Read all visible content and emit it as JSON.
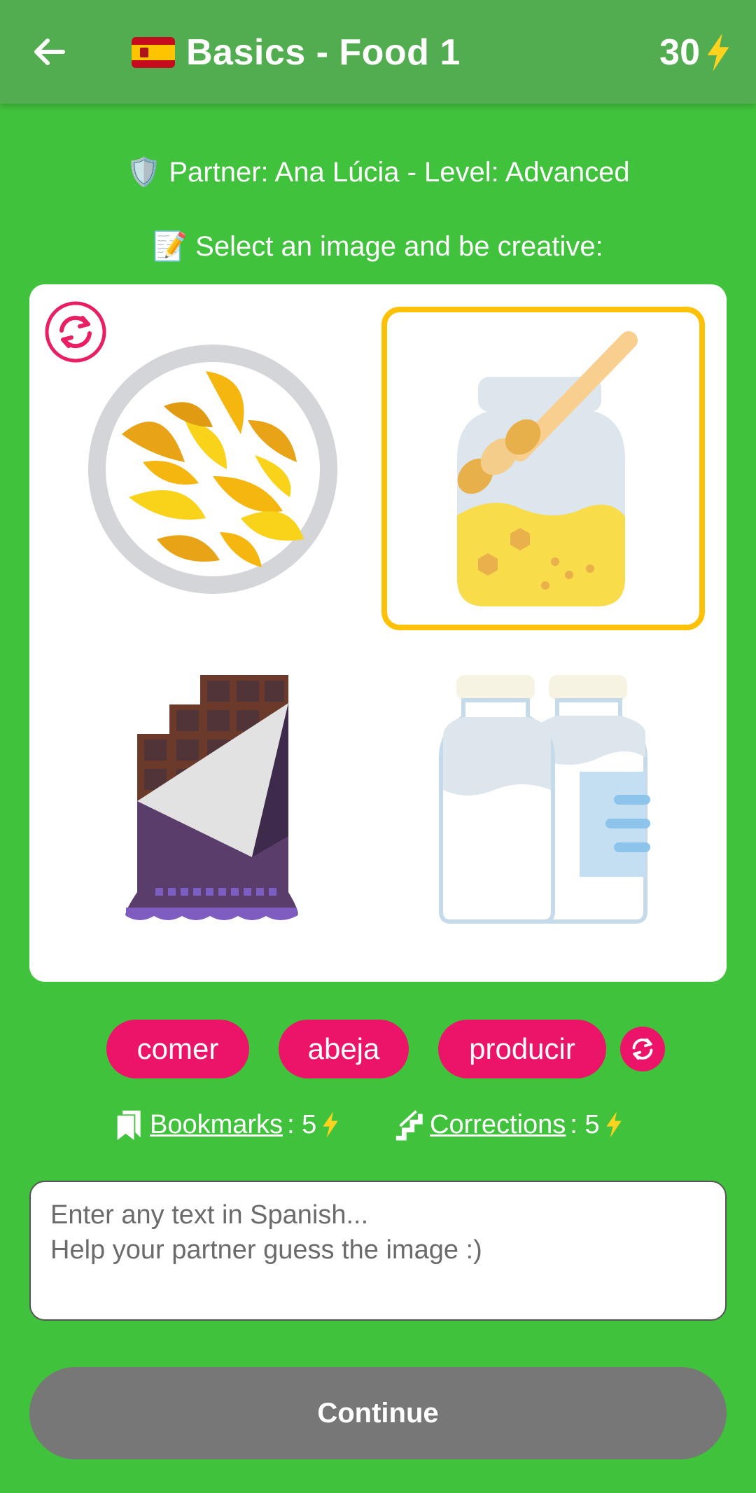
{
  "header": {
    "title": "Basics - Food 1",
    "flag_icon": "spain-flag-icon",
    "score": "30",
    "score_icon": "lightning-icon"
  },
  "partner_line": "🛡️ Partner: Ana Lúcia - Level: Advanced",
  "instruction_line": "📝 Select an image and be creative:",
  "images": [
    {
      "icon": "potato-wedges-plate-icon",
      "selected": false
    },
    {
      "icon": "honey-jar-icon",
      "selected": true
    },
    {
      "icon": "chocolate-bar-icon",
      "selected": false
    },
    {
      "icon": "milk-bottles-icon",
      "selected": false
    }
  ],
  "words": [
    "comer",
    "abeja",
    "producir"
  ],
  "stats": {
    "bookmarks_label": "Bookmarks",
    "bookmarks_value": ": 5",
    "corrections_label": "Corrections",
    "corrections_value": ": 5"
  },
  "input": {
    "placeholder": "Enter any text in Spanish...\nHelp your partner guess the image :)",
    "value": ""
  },
  "continue_label": "Continue",
  "colors": {
    "background": "#41c23c",
    "appbar": "#52ad50",
    "accent_pink": "#eb1469",
    "selection_border": "#ffc107",
    "button_disabled": "#777777"
  }
}
